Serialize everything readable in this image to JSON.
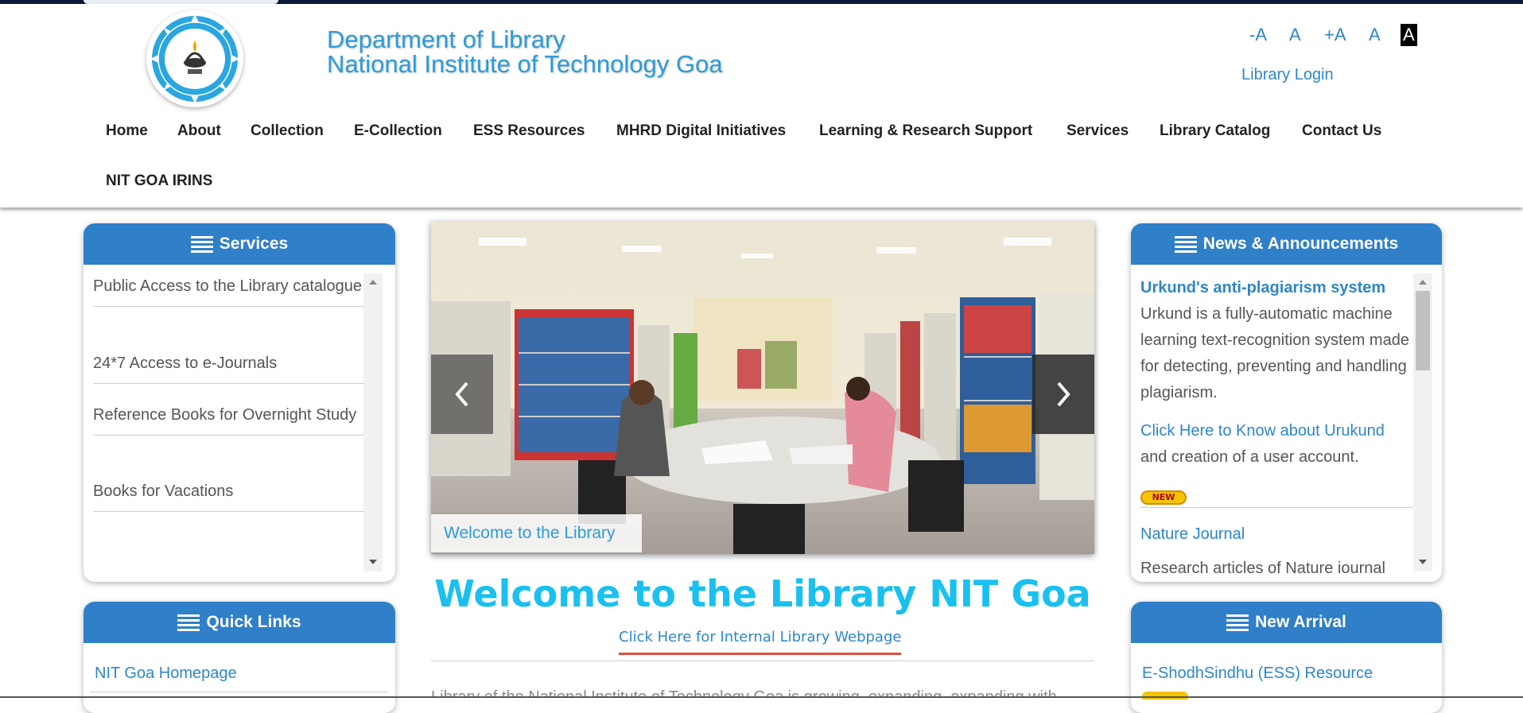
{
  "header": {
    "title_line1": "Department of Library",
    "title_line2": "National Institute of Technology Goa",
    "font_controls": [
      "-A",
      "A",
      "+A",
      "A",
      "A"
    ],
    "login_label": "Library Login"
  },
  "nav": {
    "items": [
      "Home",
      "About",
      "Collection",
      "E-Collection",
      "ESS Resources",
      "MHRD Digital Initiatives",
      "Learning & Research Support",
      "Services",
      "Library Catalog",
      "Contact Us",
      "NIT GOA IRINS"
    ]
  },
  "services": {
    "title": "Services",
    "items": [
      "Public Access to the Library catalogue",
      "24*7 Access to e-Journals",
      "Reference Books for Overnight Study",
      "Books for Vacations"
    ]
  },
  "slider": {
    "caption": "Welcome to the Library",
    "prev_icon": "chevron-left-icon",
    "next_icon": "chevron-right-icon"
  },
  "main": {
    "welcome": "Welcome to the Library NIT Goa",
    "internal_link": "Click Here for Internal Library Webpage",
    "intro_partial": "Library of the National Institute of Technology Goa is growing, expanding, expanding with"
  },
  "news": {
    "title": "News & Announcements",
    "item1_title": "Urkund's anti-plagiarism system",
    "item1_body": "Urkund is a fully-automatic machine learning text-recognition system made for detecting, preventing and handling plagiarism.",
    "item1_link": "Click Here to Know  about Urukund",
    "item1_link_suffix": " and creation of a user account.",
    "new_badge": "NEW",
    "item2_link": "Nature Journal",
    "item2_body": "Research articles of Nature journal"
  },
  "quick_links": {
    "title": "Quick Links",
    "items": [
      "NIT Goa Homepage"
    ]
  },
  "new_arrival": {
    "title": "New Arrival",
    "items": [
      "E-ShodhSindhu (ESS) Resource"
    ]
  },
  "colors": {
    "panel_header": "#2f7fc9",
    "title": "#2d9bd9",
    "welcome": "#19c0f0",
    "link": "#2e86c9",
    "accent_underline": "#e34b3b"
  }
}
